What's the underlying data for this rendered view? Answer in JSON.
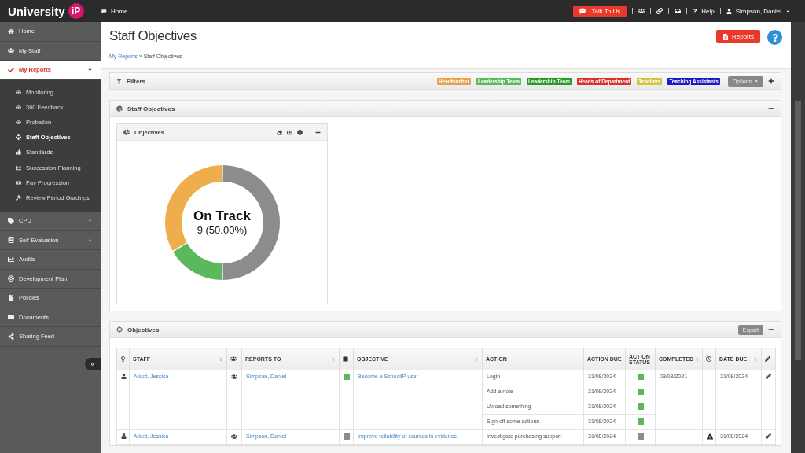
{
  "brand": {
    "name": "University",
    "badge": "iP"
  },
  "topbar": {
    "home": "Home",
    "talk": "Talk To Us",
    "help": "Help",
    "user": "Simpson, Daniel"
  },
  "sidebar": {
    "items": [
      {
        "label": "Home",
        "selected": false
      },
      {
        "label": "My Staff",
        "selected": false
      },
      {
        "label": "My Reports",
        "selected": true,
        "expanded": true,
        "children": [
          {
            "label": "Monitoring",
            "selected": false
          },
          {
            "label": "360 Feedback",
            "selected": false
          },
          {
            "label": "Probation",
            "selected": false
          },
          {
            "label": "Staff Objectives",
            "selected": true
          },
          {
            "label": "Standards",
            "selected": false
          },
          {
            "label": "Succession Planning",
            "selected": false
          },
          {
            "label": "Pay Progression",
            "selected": false
          },
          {
            "label": "Review Period Gradings",
            "selected": false
          }
        ]
      },
      {
        "label": "CPD",
        "selected": false,
        "expanded": false
      },
      {
        "label": "Self-Evaluation",
        "selected": false,
        "expanded": false
      },
      {
        "label": "Audits",
        "selected": false
      },
      {
        "label": "Development Plan",
        "selected": false
      },
      {
        "label": "Policies",
        "selected": false
      },
      {
        "label": "Documents",
        "selected": false
      },
      {
        "label": "Sharing Feed",
        "selected": false
      }
    ],
    "collapse": "«"
  },
  "page": {
    "title": "Staff Objectives",
    "breadcrumb_link": "My Reports",
    "breadcrumb_current": "» Staff Objectives",
    "reports_button": "Reports"
  },
  "filters": {
    "title": "Filters",
    "options": "Options",
    "tags": [
      {
        "label": "Headteacher",
        "color": "#e8a04c"
      },
      {
        "label": "Leadership Team",
        "color": "#5cb85c"
      },
      {
        "label": "Leadership Team",
        "color": "#2a9a2a"
      },
      {
        "label": "Heads of Department",
        "color": "#d9312b"
      },
      {
        "label": "Teachers",
        "color": "#d4c240"
      },
      {
        "label": "Teaching Assistants",
        "color": "#1c1cbf"
      }
    ]
  },
  "summary": {
    "title": "Staff Objectives",
    "widget_title": "Objectives",
    "center_title": "On Track",
    "center_value": "9 (50.00%)"
  },
  "objectives": {
    "title": "Objectives",
    "export": "Export",
    "columns": [
      {
        "label": "STAFF",
        "sortable": true
      },
      {
        "label": "REPORTS TO",
        "sortable": true
      },
      {
        "label": "OBJECTIVE",
        "sortable": true
      },
      {
        "label": "ACTION"
      },
      {
        "label": "ACTION DUE"
      },
      {
        "label": "ACTION STATUS"
      },
      {
        "label": "COMPLETED",
        "sortable": true
      },
      {
        "label": "DATE DUE",
        "sortable": true
      }
    ],
    "rows": [
      {
        "staff": "Allcot, Jessica",
        "reports_to": "Simpson, Daniel",
        "color": "#5cb85c",
        "objective": "Become a SchoolIP user",
        "completed": "03/08/2021",
        "overdue": false,
        "date_due": "31/08/2024",
        "actions": [
          {
            "action": "Login",
            "due": "31/08/2024",
            "color": "#5cb85c"
          },
          {
            "action": "Add a note",
            "due": "31/08/2024",
            "color": "#5cb85c"
          },
          {
            "action": "Upload something",
            "due": "31/08/2024",
            "color": "#5cb85c"
          },
          {
            "action": "Sign off some actions",
            "due": "31/08/2024",
            "color": "#5cb85c"
          }
        ]
      },
      {
        "staff": "Allcot, Jessica",
        "reports_to": "Simpson, Daniel",
        "color": "#8c8c8c",
        "objective": "Improve reliability of sources in evidence.",
        "overdue": true,
        "date_due": "31/08/2024",
        "actions": [
          {
            "action": "Investigate purchasing support",
            "due": "31/08/2024",
            "color": "#8c8c8c"
          }
        ]
      }
    ]
  }
}
